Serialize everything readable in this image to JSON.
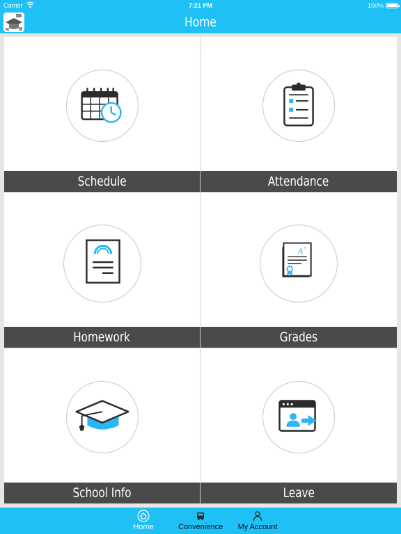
{
  "status_bar": {
    "carrier": "Carrier",
    "time": "7:21 PM",
    "battery": "100%"
  },
  "nav": {
    "title": "Home"
  },
  "tiles": [
    {
      "label": "Schedule",
      "icon": "calendar-clock-icon"
    },
    {
      "label": "Attendance",
      "icon": "clipboard-checklist-icon"
    },
    {
      "label": "Homework",
      "icon": "document-icon"
    },
    {
      "label": "Grades",
      "icon": "graded-paper-icon"
    },
    {
      "label": "School Info",
      "icon": "graduation-cap-icon"
    },
    {
      "label": "Leave",
      "icon": "user-exit-icon"
    }
  ],
  "tabs": [
    {
      "label": "Home",
      "icon": "home-icon",
      "active": true
    },
    {
      "label": "Convenience",
      "icon": "bus-icon",
      "active": false
    },
    {
      "label": "My Account",
      "icon": "user-icon",
      "active": false
    }
  ],
  "colors": {
    "brand": "#1ec0f5",
    "label_bar": "#4a4a4a",
    "accent_blue": "#29b6f6",
    "icon_dark": "#2b2b2b"
  }
}
